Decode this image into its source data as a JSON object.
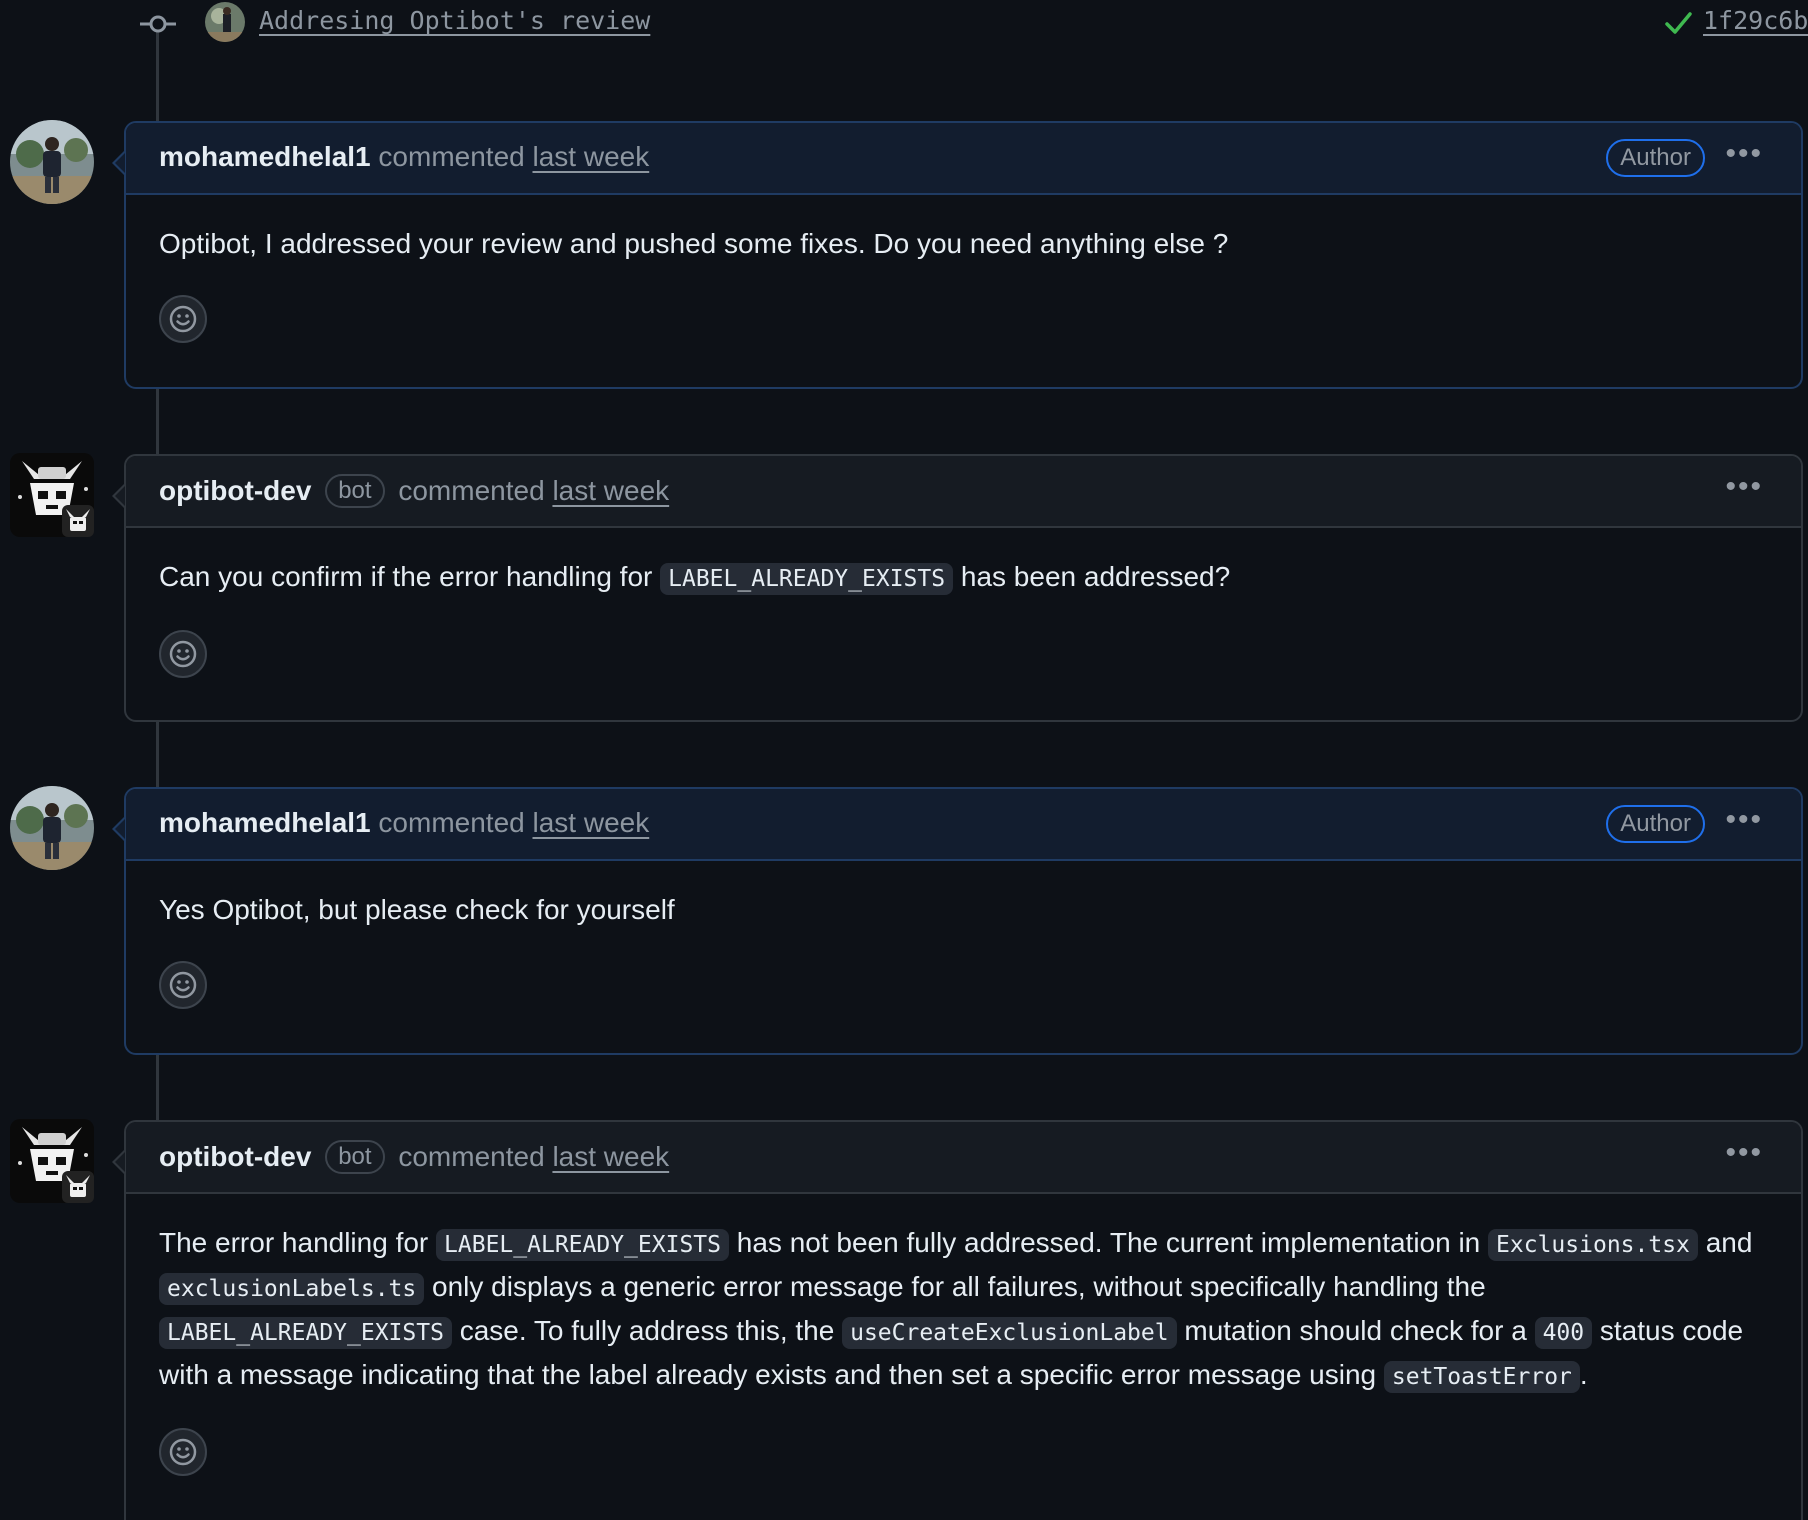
{
  "commit": {
    "message": "Addresing Optibot's review",
    "sha": "1f29c6b"
  },
  "comments": [
    {
      "user": "mohamedhelal1",
      "verb": "commented",
      "when": "last week",
      "badge": "Author",
      "body": "Optibot, I addressed your review and pushed some fixes. Do you need anything else ?"
    },
    {
      "user": "optibot-dev",
      "tag": "bot",
      "verb": "commented",
      "when": "last week",
      "body_parts": [
        "Can you confirm if the error handling for ",
        "LABEL_ALREADY_EXISTS",
        " has been addressed?"
      ]
    },
    {
      "user": "mohamedhelal1",
      "verb": "commented",
      "when": "last week",
      "badge": "Author",
      "body": "Yes Optibot, but please check for yourself"
    },
    {
      "user": "optibot-dev",
      "tag": "bot",
      "verb": "commented",
      "when": "last week",
      "body_parts": [
        "The error handling for ",
        "LABEL_ALREADY_EXISTS",
        " has not been fully addressed. The current implementation in ",
        "Exclusions.tsx",
        " and ",
        "exclusionLabels.ts",
        " only displays a generic error message for all failures, without specifically handling the ",
        "LABEL_ALREADY_EXISTS",
        " case. To fully address this, the ",
        "useCreateExclusionLabel",
        " mutation should check for a ",
        "400",
        " status code with a message indicating that the label already exists and then set a specific error message using ",
        "setToastError",
        "."
      ]
    }
  ],
  "icons": {
    "commit": "git-commit-icon",
    "check": "check-icon",
    "menu": "kebab-menu-icon",
    "reaction": "smiley-icon"
  },
  "colors": {
    "background": "#0d1117",
    "author_border": "#1f3b63",
    "check_green": "#3fb950",
    "author_badge_border": "#1f6feb"
  }
}
